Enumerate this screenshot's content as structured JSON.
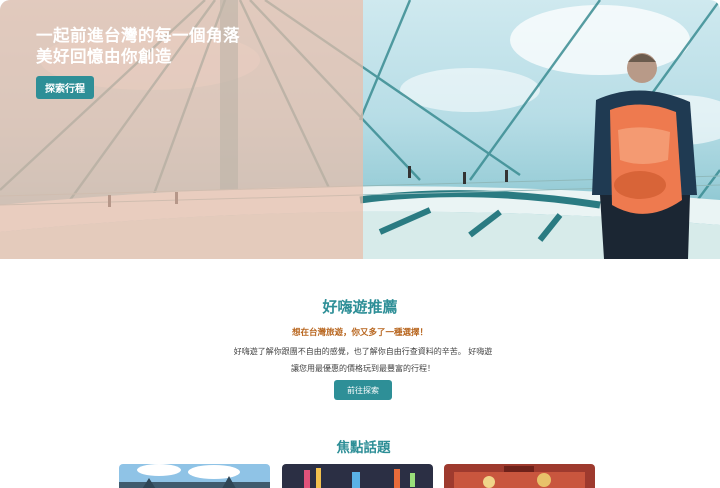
{
  "hero": {
    "title_line1": "一起前進台灣的每一個角落",
    "title_line2": "美好回憶由你創造",
    "cta_label": "探索行程"
  },
  "recommend": {
    "title": "好嗨遊推薦",
    "subtitle": "想在台灣旅遊，你又多了一種選擇！",
    "body_line1": "好嗨遊了解你跟團不自由的感覺，也了解你自由行查資料的辛苦。 好嗨遊",
    "body_line2": "讓您用最優惠的價格玩到最豐富的行程！",
    "cta_label": "前往探索"
  },
  "focus": {
    "title": "焦點話題",
    "cards": [
      {
        "id": "card-1"
      },
      {
        "id": "card-2"
      },
      {
        "id": "card-3"
      }
    ]
  },
  "colors": {
    "brand_teal": "#2e8f97",
    "accent_orange": "#b8661f",
    "hero_overlay": "#e9beaa"
  }
}
